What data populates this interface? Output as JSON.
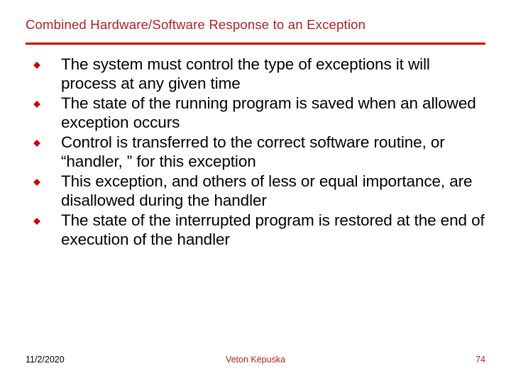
{
  "title": "Combined Hardware/Software Response to an Exception",
  "bullets": [
    "The system must control the type of exceptions it will process at any given time",
    "The state of the running program is saved when an allowed exception occurs",
    "Control is transferred to the correct software routine, or “handler, ” for this exception",
    "This exception, and others of less or equal importance, are disallowed during the handler",
    "The state of the interrupted program is restored at the end of execution of the handler"
  ],
  "footer": {
    "date": "11/2/2020",
    "author": "Veton Këpuska",
    "page": "74"
  }
}
